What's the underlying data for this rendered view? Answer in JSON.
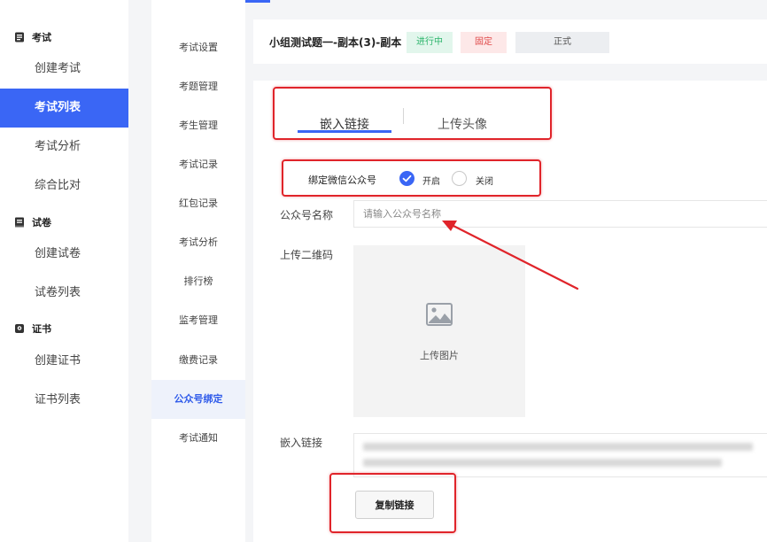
{
  "sidebar": {
    "sections": [
      {
        "title": "考试",
        "icon": "exam-doc-icon",
        "items": [
          "创建考试",
          "考试列表",
          "考试分析",
          "综合比对"
        ]
      },
      {
        "title": "试卷",
        "icon": "paper-book-icon",
        "items": [
          "创建试卷",
          "试卷列表"
        ]
      },
      {
        "title": "证书",
        "icon": "certificate-icon",
        "items": [
          "创建证书",
          "证书列表"
        ]
      }
    ],
    "active_item": "考试列表"
  },
  "subnav": {
    "items": [
      "考试设置",
      "考题管理",
      "考生管理",
      "考试记录",
      "红包记录",
      "考试分析",
      "排行榜",
      "监考管理",
      "缴费记录",
      "公众号绑定",
      "考试通知"
    ],
    "active_item": "公众号绑定"
  },
  "header": {
    "exam_title": "小组测试题一-副本(3)-副本",
    "tags": {
      "status": "进行中",
      "fixed": "固定",
      "mode": "正式"
    }
  },
  "tabs": {
    "embed": "嵌入链接",
    "upload_avatar": "上传头像",
    "active": "嵌入链接"
  },
  "form": {
    "bind_label": "绑定微信公众号",
    "option_on": "开启",
    "option_off": "关闭",
    "selected": "开启",
    "name_label": "公众号名称",
    "name_placeholder": "请输入公众号名称",
    "qr_label": "上传二维码",
    "upload_text": "上传图片",
    "embed_label": "嵌入链接",
    "copy_button": "复制链接"
  },
  "colors": {
    "accent": "#3a66f5",
    "annotation": "#e0242a"
  }
}
